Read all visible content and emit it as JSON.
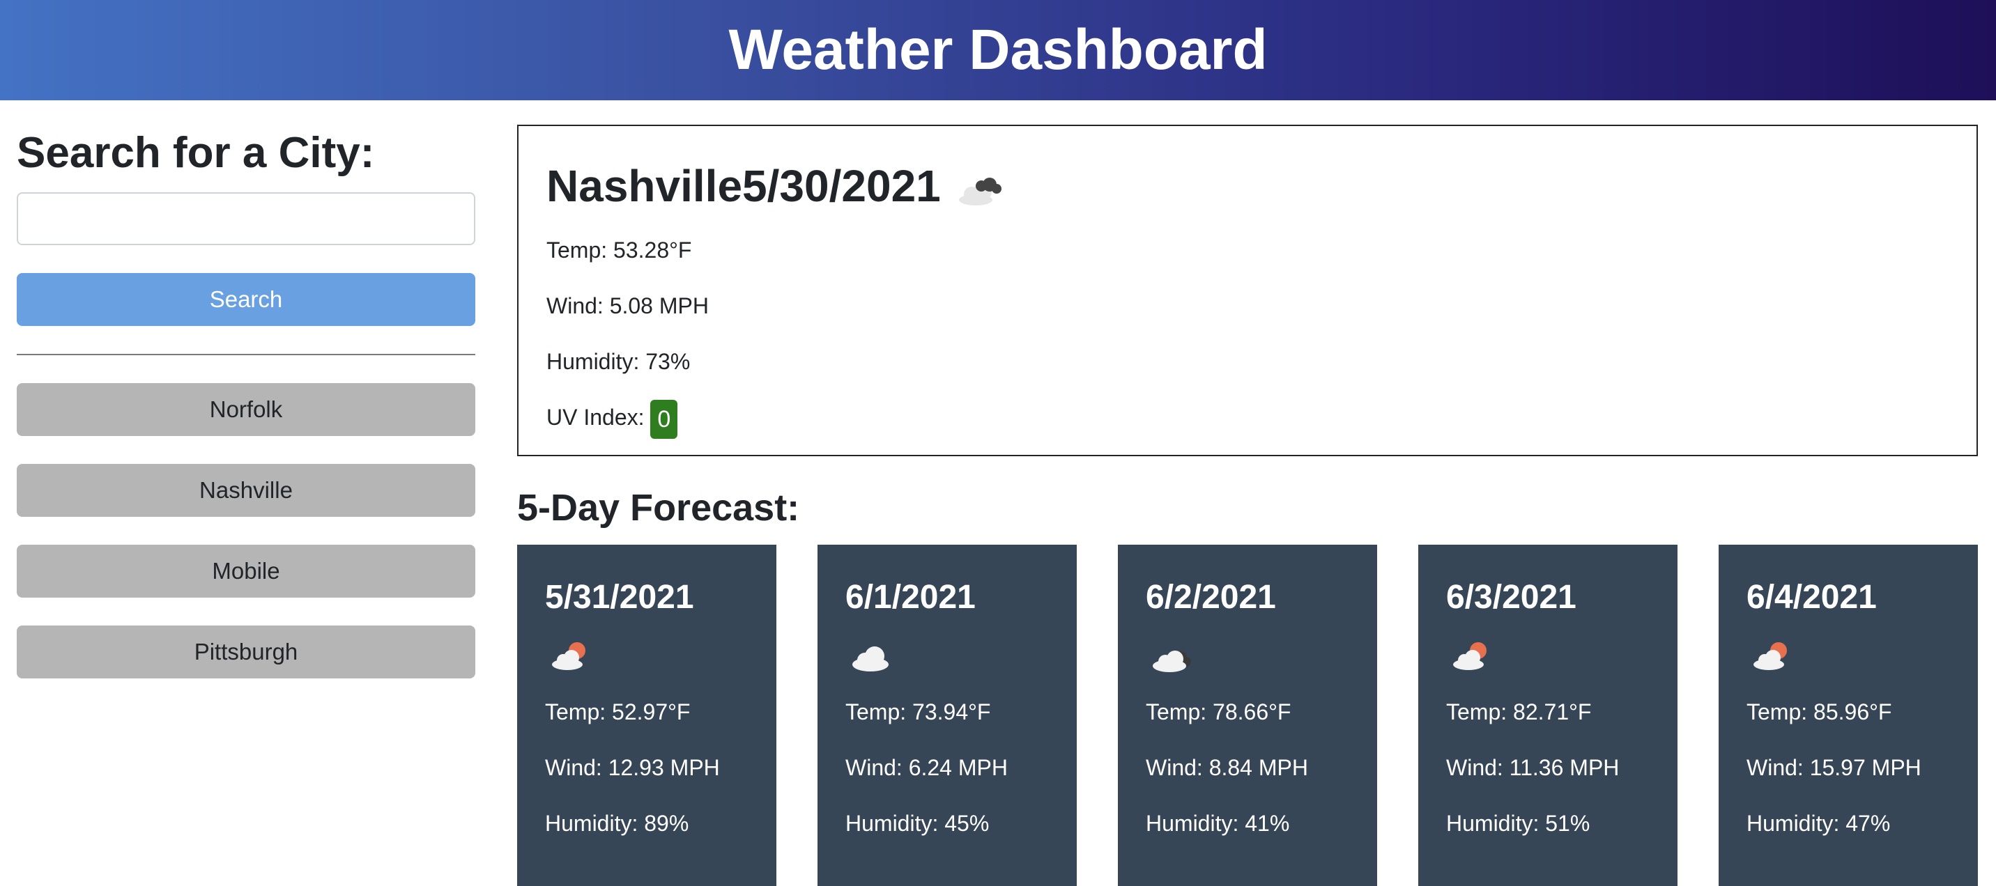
{
  "header": {
    "title": "Weather Dashboard"
  },
  "search": {
    "heading": "Search for a City:",
    "input_value": "",
    "placeholder": "",
    "button_label": "Search"
  },
  "history": [
    {
      "label": "Norfolk"
    },
    {
      "label": "Nashville"
    },
    {
      "label": "Mobile"
    },
    {
      "label": "Pittsburgh"
    }
  ],
  "current": {
    "city": "Nashville",
    "date": "5/30/2021",
    "icon": "broken-clouds-icon",
    "temp": "Temp: 53.28°F",
    "wind": "Wind: 5.08 MPH",
    "humidity": "Humidity: 73%",
    "uv_label": "UV Index: ",
    "uv_value": "0",
    "uv_color": "#2e7d1e"
  },
  "forecast": {
    "heading": "5-Day Forecast:",
    "days": [
      {
        "date": "5/31/2021",
        "icon": "few-clouds-icon",
        "temp": "Temp: 52.97°F",
        "wind": "Wind: 12.93 MPH",
        "humidity": "Humidity: 89%"
      },
      {
        "date": "6/1/2021",
        "icon": "cloud-icon",
        "temp": "Temp: 73.94°F",
        "wind": "Wind: 6.24 MPH",
        "humidity": "Humidity: 45%"
      },
      {
        "date": "6/2/2021",
        "icon": "broken-clouds-icon",
        "temp": "Temp: 78.66°F",
        "wind": "Wind: 8.84 MPH",
        "humidity": "Humidity: 41%"
      },
      {
        "date": "6/3/2021",
        "icon": "few-clouds-icon",
        "temp": "Temp: 82.71°F",
        "wind": "Wind: 11.36 MPH",
        "humidity": "Humidity: 51%"
      },
      {
        "date": "6/4/2021",
        "icon": "few-clouds-icon",
        "temp": "Temp: 85.96°F",
        "wind": "Wind: 15.97 MPH",
        "humidity": "Humidity: 47%"
      }
    ]
  },
  "colors": {
    "header_gradient_start": "#4472c4",
    "header_gradient_end": "#1e0f58",
    "search_button": "#68a0e2",
    "history_button": "#b5b5b5",
    "card_background": "#374657"
  }
}
